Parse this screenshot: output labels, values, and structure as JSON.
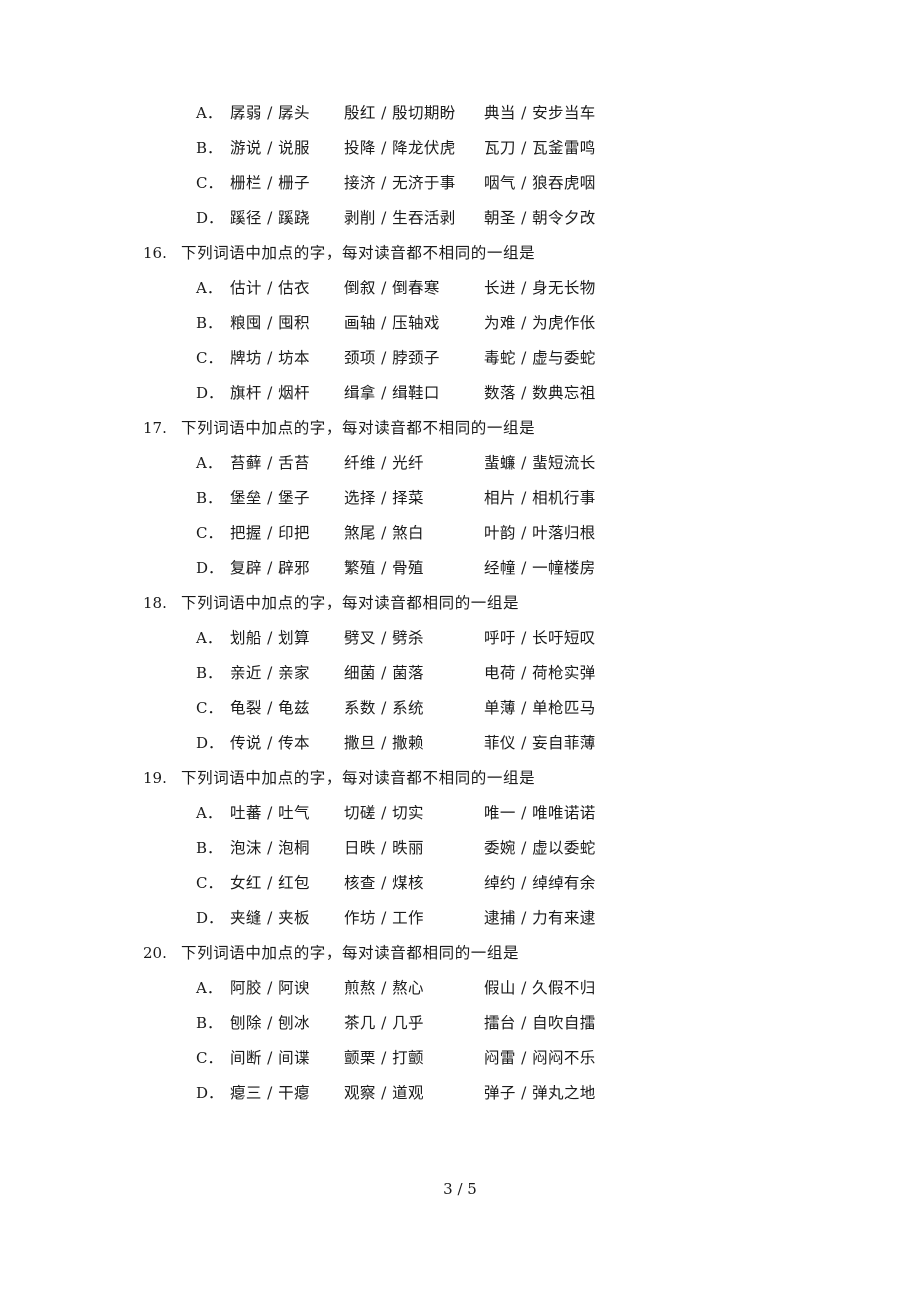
{
  "document": {
    "page_footer": "3 / 5"
  },
  "questions": [
    {
      "number": "",
      "stem": "",
      "show_stem": false,
      "options": [
        {
          "letter": "A．",
          "col1": "孱弱 / 孱头",
          "col2": "殷红 / 殷切期盼",
          "col3": "典当 / 安步当车"
        },
        {
          "letter": "B．",
          "col1": "游说 / 说服",
          "col2": "投降 / 降龙伏虎",
          "col3": "瓦刀 / 瓦釜雷鸣"
        },
        {
          "letter": "C．",
          "col1": "栅栏 / 栅子",
          "col2": "接济 / 无济于事",
          "col3": "咽气 / 狼吞虎咽"
        },
        {
          "letter": "D．",
          "col1": "蹊径 / 蹊跷",
          "col2": "剥削 / 生吞活剥",
          "col3": "朝圣 / 朝令夕改"
        }
      ]
    },
    {
      "number": "16.",
      "stem": "下列词语中加点的字，每对读音都不相同的一组是",
      "show_stem": true,
      "options": [
        {
          "letter": "A．",
          "col1": "估计 / 估衣",
          "col2": "倒叙 / 倒春寒",
          "col3": "长进 / 身无长物"
        },
        {
          "letter": "B．",
          "col1": "粮囤 / 囤积",
          "col2": "画轴 / 压轴戏",
          "col3": "为难 / 为虎作伥"
        },
        {
          "letter": "C．",
          "col1": "牌坊 / 坊本",
          "col2": "颈项 / 脖颈子",
          "col3": "毒蛇 / 虚与委蛇"
        },
        {
          "letter": "D．",
          "col1": "旗杆 / 烟杆",
          "col2": "缉拿 / 缉鞋口",
          "col3": "数落 / 数典忘祖"
        }
      ]
    },
    {
      "number": "17.",
      "stem": "下列词语中加点的字，每对读音都不相同的一组是",
      "show_stem": true,
      "options": [
        {
          "letter": "A．",
          "col1": "苔藓 / 舌苔",
          "col2": "纤维 / 光纤",
          "col3": "蜚蠊 / 蜚短流长"
        },
        {
          "letter": "B．",
          "col1": "堡垒 / 堡子",
          "col2": "选择 / 择菜",
          "col3": "相片 / 相机行事"
        },
        {
          "letter": "C．",
          "col1": "把握 / 印把",
          "col2": "煞尾 / 煞白",
          "col3": "叶韵 / 叶落归根"
        },
        {
          "letter": "D．",
          "col1": "复辟 / 辟邪",
          "col2": "繁殖 / 骨殖",
          "col3": "经幢 / 一幢楼房"
        }
      ]
    },
    {
      "number": "18.",
      "stem": "下列词语中加点的字，每对读音都相同的一组是",
      "show_stem": true,
      "options": [
        {
          "letter": "A．",
          "col1": "划船 / 划算",
          "col2": "劈叉 / 劈杀",
          "col3": "呼吁 / 长吁短叹"
        },
        {
          "letter": "B．",
          "col1": "亲近 / 亲家",
          "col2": "细菌 / 菌落",
          "col3": "电荷 / 荷枪实弹"
        },
        {
          "letter": "C．",
          "col1": "龟裂 / 龟兹",
          "col2": "系数 / 系统",
          "col3": "单薄 / 单枪匹马"
        },
        {
          "letter": "D．",
          "col1": "传说 / 传本",
          "col2": "撒旦 / 撒赖",
          "col3": "菲仪 / 妄自菲薄"
        }
      ]
    },
    {
      "number": "19.",
      "stem": "下列词语中加点的字，每对读音都不相同的一组是",
      "show_stem": true,
      "options": [
        {
          "letter": "A．",
          "col1": "吐蕃 / 吐气",
          "col2": "切磋 / 切实",
          "col3": "唯一 / 唯唯诺诺"
        },
        {
          "letter": "B．",
          "col1": "泡沫 / 泡桐",
          "col2": "日昳 / 昳丽",
          "col3": "委婉 / 虚以委蛇"
        },
        {
          "letter": "C．",
          "col1": "女红 / 红包",
          "col2": "核查 / 煤核",
          "col3": "绰约 / 绰绰有余"
        },
        {
          "letter": "D．",
          "col1": "夹缝 / 夹板",
          "col2": "作坊 / 工作",
          "col3": "逮捕 / 力有来逮"
        }
      ]
    },
    {
      "number": "20.",
      "stem": "下列词语中加点的字，每对读音都相同的一组是",
      "show_stem": true,
      "options": [
        {
          "letter": "A．",
          "col1": "阿胶 / 阿谀",
          "col2": "煎熬 / 熬心",
          "col3": "假山 / 久假不归"
        },
        {
          "letter": "B．",
          "col1": "刨除 / 刨冰",
          "col2": "茶几 / 几乎",
          "col3": "擂台 / 自吹自擂"
        },
        {
          "letter": "C．",
          "col1": "间断 / 间谍",
          "col2": "颤栗 / 打颤",
          "col3": "闷雷 / 闷闷不乐"
        },
        {
          "letter": "D．",
          "col1": "瘪三 / 干瘪",
          "col2": "观察 / 道观",
          "col3": "弹子 / 弹丸之地"
        }
      ]
    }
  ]
}
